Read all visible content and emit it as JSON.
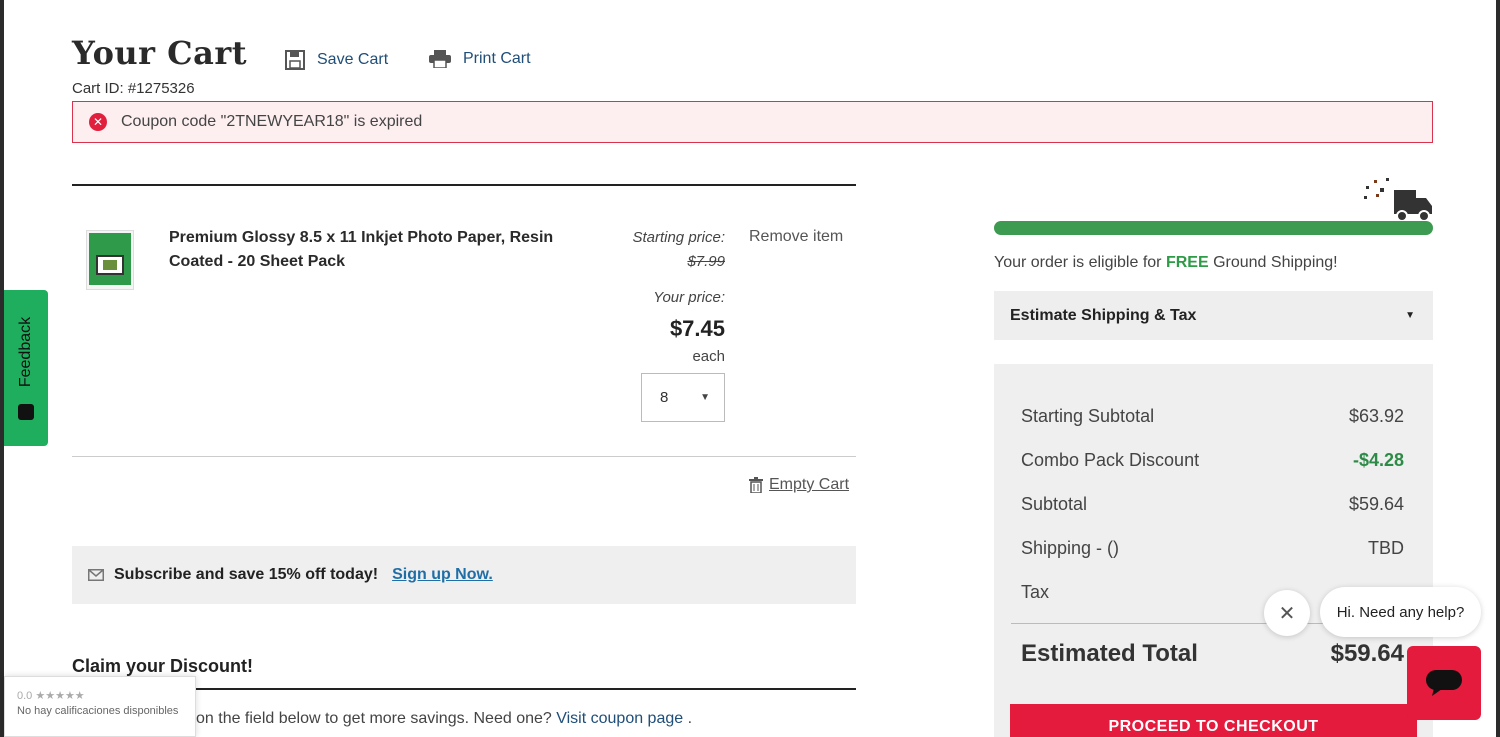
{
  "header": {
    "title": "Your Cart",
    "save_label": "Save Cart",
    "print_label": "Print Cart",
    "cart_id": "Cart ID: #1275326"
  },
  "alert": {
    "message": "Coupon code \"2TNEWYEAR18\" is expired",
    "icon": "error-circle-icon"
  },
  "item": {
    "name_line1": "Premium Glossy 8.5 x 11 Inkjet Photo Paper, Resin",
    "name_line2": "Coated - 20 Sheet Pack",
    "starting_label": "Starting price:",
    "starting_price": "$7.99",
    "your_label": "Your price:",
    "your_price": "$7.45",
    "each": "each",
    "quantity": "8",
    "remove_label": "Remove item"
  },
  "empty_cart_label": "Empty Cart",
  "subscribe": {
    "text": "Subscribe and save 15% off today!",
    "link": "Sign up Now."
  },
  "discount": {
    "title": "Claim your Discount!",
    "text": "on the field below to get more savings. Need one?",
    "link": "Visit coupon page",
    "end": "."
  },
  "feedback_label": "Feedback",
  "ratings": {
    "score": "0.0",
    "stars": "★★★★★",
    "text": "No hay calificaciones disponibles"
  },
  "shipping": {
    "msg_prefix": "Your order is eligible for",
    "msg_free": "FREE",
    "msg_suffix": "Ground Shipping!",
    "progress": 1.0,
    "estimate_label": "Estimate Shipping & Tax"
  },
  "summary": {
    "rows": [
      {
        "label": "Starting Subtotal",
        "value": "$63.92"
      },
      {
        "label": "Combo Pack Discount",
        "value": "-$4.28"
      },
      {
        "label": "Subtotal",
        "value": "$59.64"
      },
      {
        "label": "Shipping - ()",
        "value": "TBD"
      },
      {
        "label": "Tax",
        "value": ""
      }
    ],
    "total_label": "Estimated Total",
    "total_value": "$59.64",
    "checkout_label": "PROCEED TO CHECKOUT"
  },
  "chat": {
    "greeting": "Hi. Need any help?",
    "close": "✕"
  },
  "colors": {
    "accent_red": "#e41b3d",
    "green": "#3d9b51",
    "link_blue": "#1f4e79"
  }
}
